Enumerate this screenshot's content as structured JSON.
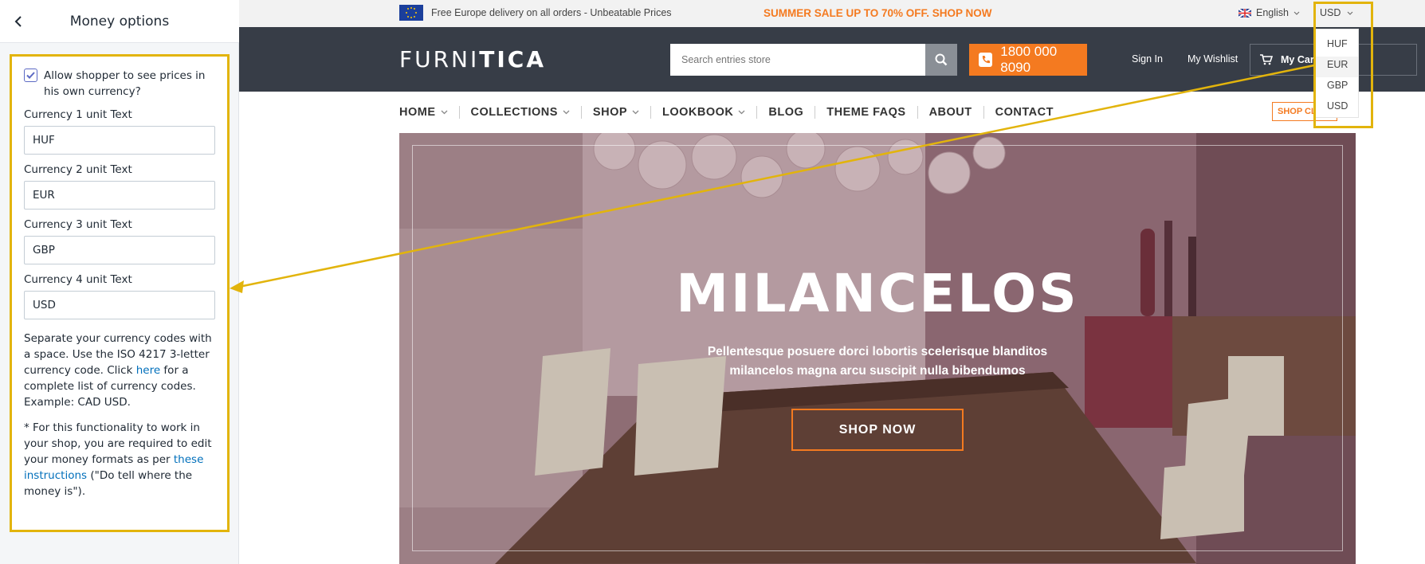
{
  "panel": {
    "title": "Money options",
    "checkbox_label": "Allow shopper to see prices in his own currency?",
    "checkbox_checked": true,
    "fields": [
      {
        "label": "Currency 1 unit Text",
        "value": "HUF"
      },
      {
        "label": "Currency 2 unit Text",
        "value": "EUR"
      },
      {
        "label": "Currency 3 unit Text",
        "value": "GBP"
      },
      {
        "label": "Currency 4 unit Text",
        "value": "USD"
      }
    ],
    "help1_before": "Separate your currency codes with a space. Use the ISO 4217 3-letter currency code. Click ",
    "help1_link": "here",
    "help1_after": " for a complete list of currency codes. Example: CAD USD.",
    "help2_before": "* For this functionality to work in your shop, you are required to edit your money formats as per ",
    "help2_link": "these instructions",
    "help2_after": " (\"Do tell where the money is\")."
  },
  "topbar": {
    "promo": "Free Europe delivery on all orders - Unbeatable Prices",
    "sale": "SUMMER SALE UP TO 70% OFF. SHOP NOW",
    "language": "English",
    "currency": "USD"
  },
  "header": {
    "logo_light": "FURNI",
    "logo_bold": "TICA",
    "search_placeholder": "Search entries store",
    "phone": "1800 000 8090",
    "signin": "Sign In",
    "wishlist": "My Wishlist",
    "cart": "My Cart"
  },
  "currency_dropdown": {
    "items": [
      "HUF",
      "EUR",
      "GBP",
      "USD"
    ],
    "active": "EUR"
  },
  "nav": {
    "items": [
      {
        "label": "HOME",
        "has_dropdown": true
      },
      {
        "label": "COLLECTIONS",
        "has_dropdown": true
      },
      {
        "label": "SHOP",
        "has_dropdown": true
      },
      {
        "label": "LOOKBOOK",
        "has_dropdown": true
      },
      {
        "label": "BLOG",
        "has_dropdown": false
      },
      {
        "label": "THEME FAQS",
        "has_dropdown": false
      },
      {
        "label": "ABOUT",
        "has_dropdown": false
      },
      {
        "label": "CONTACT",
        "has_dropdown": false
      }
    ],
    "shop_clearance": "SHOP CLEARANCE"
  },
  "hero": {
    "title": "MILANCELOS",
    "subtitle": "Pellentesque posuere dorci lobortis scelerisque blanditos milancelos magna arcu suscipit nulla bibendumos",
    "button": "SHOP NOW"
  },
  "colors": {
    "highlight": "#e2b40c",
    "accent": "#f47a20",
    "header_bg": "#373d47",
    "link": "#006fbb"
  }
}
